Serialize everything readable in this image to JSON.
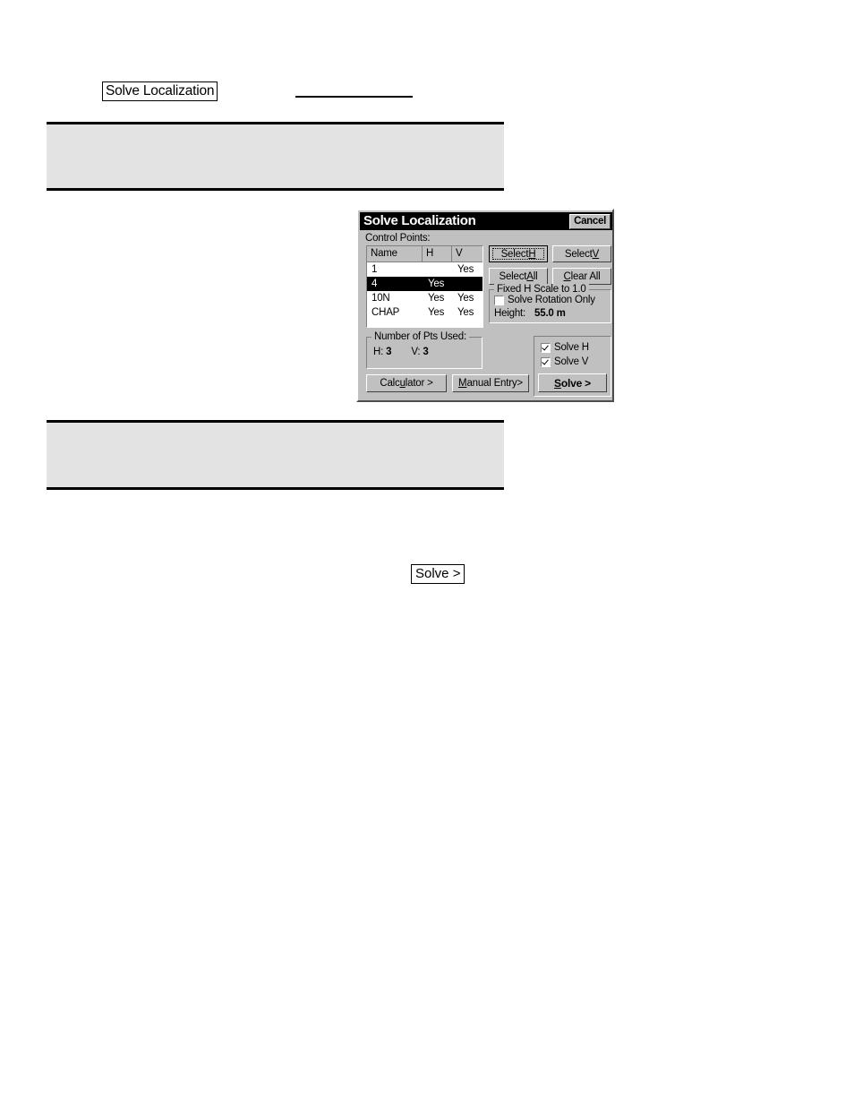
{
  "page": {
    "heading_box": "Solve Localization",
    "inline_box": "Solve >"
  },
  "dialog": {
    "title": "Solve Localization",
    "cancel_label": "Cancel",
    "control_points_label": "Control Points:",
    "table": {
      "columns": [
        "Name",
        "H",
        "V"
      ],
      "rows": [
        {
          "name": "1",
          "h": "",
          "v": "Yes",
          "selected": false
        },
        {
          "name": "4",
          "h": "Yes",
          "v": "",
          "selected": true
        },
        {
          "name": "10N",
          "h": "Yes",
          "v": "Yes",
          "selected": false
        },
        {
          "name": "CHAP",
          "h": "Yes",
          "v": "Yes",
          "selected": false
        }
      ]
    },
    "buttons": {
      "select_h": {
        "pre": "Select ",
        "accel": "H",
        "post": "",
        "default": true
      },
      "select_v": {
        "pre": "Select ",
        "accel": "V",
        "post": ""
      },
      "select_all": {
        "pre": "Select ",
        "accel": "A",
        "post": "ll"
      },
      "clear_all": {
        "pre": "",
        "accel": "C",
        "post": "lear All"
      },
      "calculator": {
        "pre": "Calc",
        "accel": "u",
        "post": "lator >"
      },
      "manual_entry": {
        "pre": "",
        "accel": "M",
        "post": "anual Entry>"
      },
      "solve": {
        "pre": "",
        "accel": "S",
        "post": "olve >"
      }
    },
    "fixed_scale_group": {
      "title": "Fixed H Scale to 1.0",
      "rotation_checkbox": {
        "label": "Solve Rotation Only",
        "checked": false
      },
      "height_label": "Height:",
      "height_value": "55.0 m"
    },
    "pts_group": {
      "title": "Number of Pts Used:",
      "h_label": "H:",
      "h_value": "3",
      "v_label": "V:",
      "v_value": "3"
    },
    "solve_group": {
      "solve_h": {
        "label": "Solve H",
        "checked": true
      },
      "solve_v": {
        "label": "Solve V",
        "checked": true
      }
    }
  },
  "colors": {
    "dialog_face": "#c0c0c0",
    "titlebar": "#000000",
    "titlebar_text": "#ffffff",
    "selection": "#000000",
    "redacted_block": "#e3e3e3",
    "page_background": "#ffffff"
  }
}
